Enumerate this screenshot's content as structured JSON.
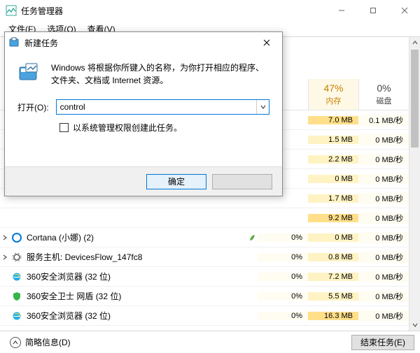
{
  "window": {
    "title": "任务管理器"
  },
  "menu": {
    "file": "文件(F)",
    "options": "选项(O)",
    "view": "查看(V)"
  },
  "columns": {
    "cpu_pct": "",
    "cpu_lbl": "",
    "mem_pct": "47%",
    "mem_lbl": "内存",
    "disk_pct": "0%",
    "disk_lbl": "磁盘"
  },
  "rows": [
    {
      "name": "",
      "cpu": "",
      "mem": "7.0 MB",
      "disk": "0.1 MB/秒",
      "exp": "",
      "hl": true
    },
    {
      "name": "",
      "cpu": "",
      "mem": "1.5 MB",
      "disk": "0 MB/秒",
      "exp": ""
    },
    {
      "name": "",
      "cpu": "",
      "mem": "2.2 MB",
      "disk": "0 MB/秒",
      "exp": ""
    },
    {
      "name": "",
      "cpu": "",
      "mem": "0 MB",
      "disk": "0 MB/秒",
      "exp": ""
    },
    {
      "name": "",
      "cpu": "",
      "mem": "1.7 MB",
      "disk": "0 MB/秒",
      "exp": ""
    },
    {
      "name": "",
      "cpu": "",
      "mem": "9.2 MB",
      "disk": "0 MB/秒",
      "exp": "",
      "sel": true,
      "hl": true
    },
    {
      "name": "Cortana (小娜) (2)",
      "cpu": "0%",
      "mem": "0 MB",
      "disk": "0 MB/秒",
      "exp": ">",
      "leaf": true,
      "icon": "cortana"
    },
    {
      "name": "服务主机: DevicesFlow_147fc8",
      "cpu": "0%",
      "mem": "0.8 MB",
      "disk": "0 MB/秒",
      "exp": ">",
      "icon": "svc"
    },
    {
      "name": "360安全浏览器 (32 位)",
      "cpu": "0%",
      "mem": "7.2 MB",
      "disk": "0 MB/秒",
      "exp": "",
      "icon": "ie"
    },
    {
      "name": "360安全卫士 网盾 (32 位)",
      "cpu": "0%",
      "mem": "5.5 MB",
      "disk": "0 MB/秒",
      "exp": "",
      "icon": "shield"
    },
    {
      "name": "360安全浏览器 (32 位)",
      "cpu": "0%",
      "mem": "16.3 MB",
      "disk": "0 MB/秒",
      "exp": "",
      "icon": "ie",
      "hl": true
    }
  ],
  "footer": {
    "less": "简略信息(D)",
    "endtask": "结束任务(E)"
  },
  "rundlg": {
    "title": "新建任务",
    "desc": "Windows 将根据你所键入的名称，为你打开相应的程序、文件夹、文档或 Internet 资源。",
    "open_label": "打开(O):",
    "value": "control",
    "admin_label": "以系统管理权限创建此任务。",
    "ok": "确定",
    "cancel": ""
  }
}
